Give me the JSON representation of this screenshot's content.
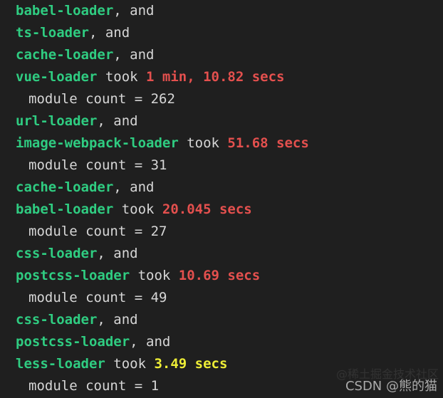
{
  "terminal": {
    "background_color": "#1f1f1f",
    "colors": {
      "loader": "#2fcc81",
      "plain": "#d6d6d6",
      "time_slow": "#e4504e",
      "time_fast": "#eded36"
    },
    "lines": [
      {
        "indent": false,
        "tokens": [
          {
            "type": "loader",
            "text": "babel-loader"
          },
          {
            "type": "plain",
            "text": ", and"
          }
        ]
      },
      {
        "indent": false,
        "tokens": [
          {
            "type": "loader",
            "text": "ts-loader"
          },
          {
            "type": "plain",
            "text": ", and"
          }
        ]
      },
      {
        "indent": false,
        "tokens": [
          {
            "type": "loader",
            "text": "cache-loader"
          },
          {
            "type": "plain",
            "text": ", and"
          }
        ]
      },
      {
        "indent": false,
        "tokens": [
          {
            "type": "loader",
            "text": "vue-loader"
          },
          {
            "type": "plain",
            "text": " took "
          },
          {
            "type": "time-slow",
            "text": "1 min, 10.82 secs"
          }
        ]
      },
      {
        "indent": true,
        "tokens": [
          {
            "type": "count",
            "text": "module count = 262"
          }
        ]
      },
      {
        "indent": false,
        "tokens": [
          {
            "type": "loader",
            "text": "url-loader"
          },
          {
            "type": "plain",
            "text": ", and"
          }
        ]
      },
      {
        "indent": false,
        "tokens": [
          {
            "type": "loader",
            "text": "image-webpack-loader"
          },
          {
            "type": "plain",
            "text": " took "
          },
          {
            "type": "time-slow",
            "text": "51.68 secs"
          }
        ]
      },
      {
        "indent": true,
        "tokens": [
          {
            "type": "count",
            "text": "module count = 31"
          }
        ]
      },
      {
        "indent": false,
        "tokens": [
          {
            "type": "loader",
            "text": "cache-loader"
          },
          {
            "type": "plain",
            "text": ", and"
          }
        ]
      },
      {
        "indent": false,
        "tokens": [
          {
            "type": "loader",
            "text": "babel-loader"
          },
          {
            "type": "plain",
            "text": " took "
          },
          {
            "type": "time-slow",
            "text": "20.045 secs"
          }
        ]
      },
      {
        "indent": true,
        "tokens": [
          {
            "type": "count",
            "text": "module count = 27"
          }
        ]
      },
      {
        "indent": false,
        "tokens": [
          {
            "type": "loader",
            "text": "css-loader"
          },
          {
            "type": "plain",
            "text": ", and"
          }
        ]
      },
      {
        "indent": false,
        "tokens": [
          {
            "type": "loader",
            "text": "postcss-loader"
          },
          {
            "type": "plain",
            "text": " took "
          },
          {
            "type": "time-slow",
            "text": "10.69 secs"
          }
        ]
      },
      {
        "indent": true,
        "tokens": [
          {
            "type": "count",
            "text": "module count = 49"
          }
        ]
      },
      {
        "indent": false,
        "tokens": [
          {
            "type": "loader",
            "text": "css-loader"
          },
          {
            "type": "plain",
            "text": ", and"
          }
        ]
      },
      {
        "indent": false,
        "tokens": [
          {
            "type": "loader",
            "text": "postcss-loader"
          },
          {
            "type": "plain",
            "text": ", and"
          }
        ]
      },
      {
        "indent": false,
        "tokens": [
          {
            "type": "loader",
            "text": "less-loader"
          },
          {
            "type": "plain",
            "text": " took "
          },
          {
            "type": "time-fast",
            "text": "3.49 secs"
          }
        ]
      },
      {
        "indent": true,
        "tokens": [
          {
            "type": "count",
            "text": "module count = 1"
          }
        ]
      }
    ]
  },
  "watermarks": {
    "juejin": "@稀土掘金技术社区",
    "csdn": "CSDN @熊的猫"
  }
}
